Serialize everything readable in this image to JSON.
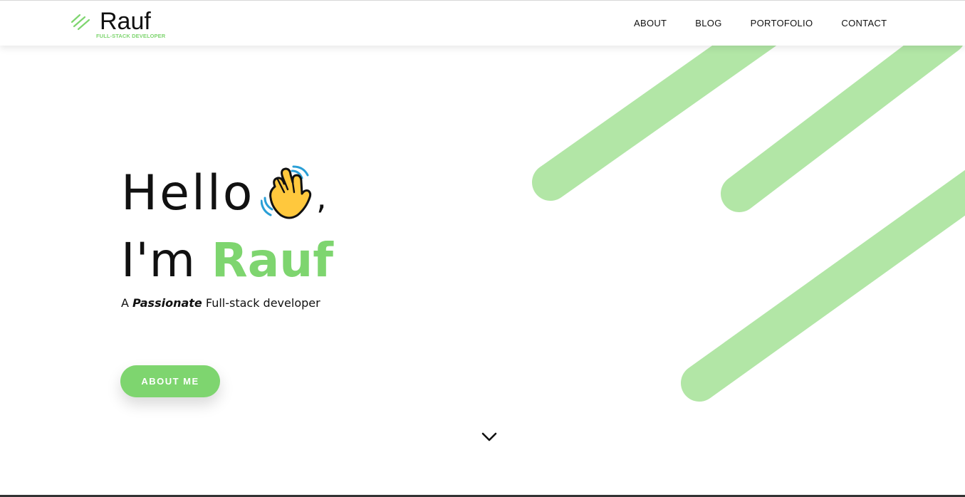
{
  "logo": {
    "text": "Rauf",
    "subtitle": "FULL-STACK DEVELOPER",
    "icon": "double-slash-logo-icon"
  },
  "nav": {
    "items": [
      {
        "label": "ABOUT"
      },
      {
        "label": "BLOG"
      },
      {
        "label": "PORTOFOLIO"
      },
      {
        "label": "CONTACT"
      }
    ]
  },
  "hero": {
    "greeting": "Hello",
    "greeting_emoji": "waving-hand-icon",
    "comma": ",",
    "intro_prefix": "I'm",
    "name": "Rauf",
    "tagline_prefix": "A",
    "tagline_emphasis": "Passionate",
    "tagline_suffix": "Full-stack developer",
    "cta_label": "ABOUT ME",
    "scroll_icon": "chevron-down-icon"
  },
  "colors": {
    "accent": "#7ed56f",
    "stripe": "#b2e6a6",
    "text": "#111111",
    "background": "#ffffff"
  }
}
